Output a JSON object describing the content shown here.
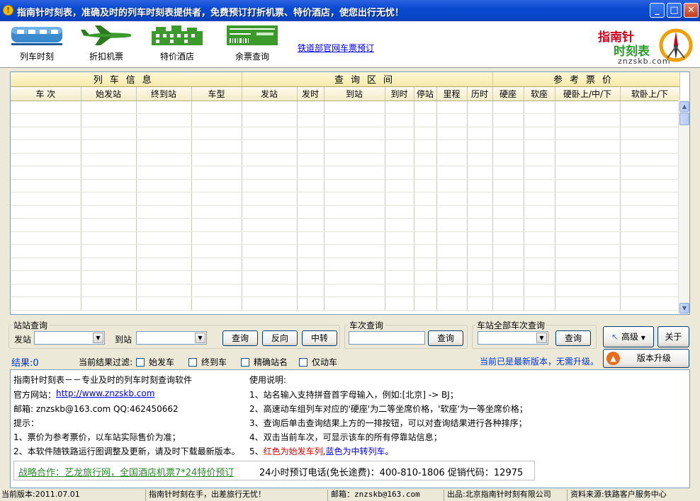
{
  "window": {
    "title": "指南针时刻表，准确及时的列车时刻表提供者，免费预订打折机票、特价酒店，使您出行无忧！",
    "buttons": [
      "minimize",
      "maximize",
      "close"
    ]
  },
  "toolbar": {
    "items": [
      {
        "label": "列车时刻",
        "icon": "train-icon"
      },
      {
        "label": "折扣机票",
        "icon": "airplane-icon"
      },
      {
        "label": "特价酒店",
        "icon": "hotel-icon"
      },
      {
        "label": "余票查询",
        "icon": "ticket-icon"
      }
    ],
    "link": "铁道部官网车票预订",
    "logo": {
      "line1": "指南针",
      "line2": "时刻表",
      "domain": "znzskb.com"
    }
  },
  "grid": {
    "groups": [
      "列车信息",
      "查询区间",
      "参考票价"
    ],
    "columns": [
      "车 次",
      "始发站",
      "终到站",
      "车型",
      "发站",
      "发时",
      "到站",
      "到时",
      "停站",
      "里程",
      "历时",
      "硬座",
      "软座",
      "硬卧上/中/下",
      "软卧上/下"
    ],
    "rows": []
  },
  "station_query": {
    "legend": "站站查询",
    "from_label": "发站",
    "to_label": "到站",
    "from_value": "",
    "to_value": "",
    "buttons": {
      "query": "查询",
      "reverse": "反向",
      "transfer": "中转"
    }
  },
  "train_query": {
    "legend": "车次查询",
    "value": "",
    "button": "查询"
  },
  "station_all_query": {
    "legend": "车站全部车次查询",
    "value": "",
    "button": "查询"
  },
  "side_buttons": {
    "advanced": "高级",
    "about": "关于",
    "upgrade": "版本升级"
  },
  "result": {
    "label": "结果:0",
    "filter_label": "当前结果过滤:",
    "filters": [
      "始发车",
      "终到车",
      "精确站名",
      "仅动车"
    ],
    "version_msg": "当前已是最新版本，无需升级。"
  },
  "info": {
    "left": [
      "指南针时刻表－－专业及时的列车时刻查询软件",
      "官方网站：",
      "http://www.znzskb.com",
      "邮箱: znzskb@163.com QQ:462450662",
      "提示：",
      "1、票价为参考票价，以车站实际售价为准；",
      "2、本软件随铁路运行图调整及更新，请及时下载最新版本。"
    ],
    "right": [
      "使用说明:",
      "1、站名输入支持拼音首字母输入，例如:[北京] -> BJ；",
      "2、高速动车组列车对应的'硬座'为二等坐席价格，'软座'为一等坐席价格；",
      "3、查询后单击查询结果上方的一排按钮，可以对查询结果进行各种排序；",
      "4、双击当前车次，可显示该车的所有停靠站信息；",
      "5、",
      "红色为始发车列",
      ",",
      "蓝色为中转列车",
      "。"
    ],
    "promo_link": "战略合作：艺龙旅行网，全国酒店机票7*24特价预订",
    "promo_text": "24小时预订电话(免长途费)：400-810-1806 促销代码：12975"
  },
  "status_bar": [
    "当前版本:2011.07.01",
    "指南针时刻在手，出差旅行无忧！",
    "邮箱：znzskb@163.com",
    "出品:北京指南针时刻有限公司",
    "资料来源:铁路客户服务中心"
  ],
  "colors": {
    "accent_red": "#d0021b",
    "accent_blue": "#0000ee",
    "promo_green": "#2a8a2a",
    "version_blue": "#0033cc"
  }
}
